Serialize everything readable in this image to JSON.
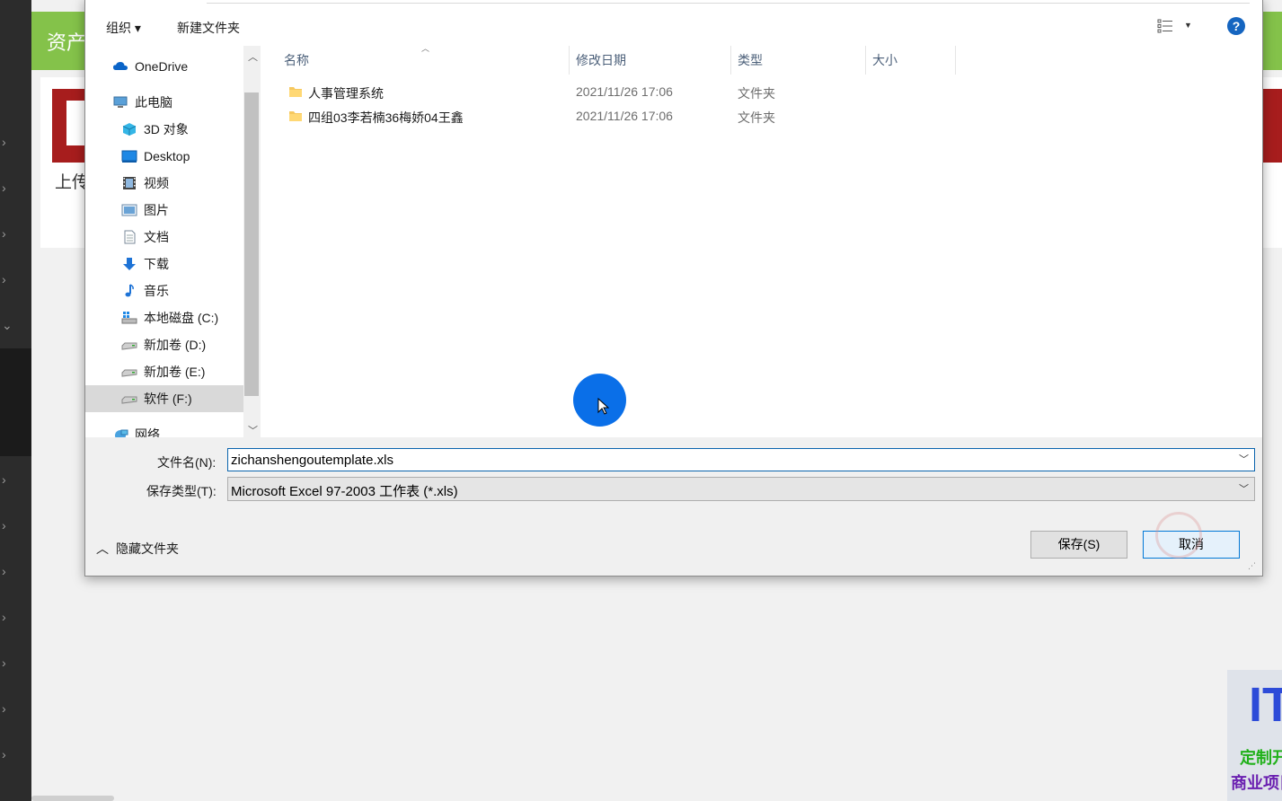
{
  "background": {
    "header_title": "资产",
    "upload_label": "上传",
    "ad": {
      "big": "IT",
      "line1": "定制开发",
      "line2": "商业项目"
    }
  },
  "dialog": {
    "toolbar": {
      "organize": "组织 ▾",
      "new_folder": "新建文件夹",
      "help": "?"
    },
    "nav": {
      "items": [
        {
          "label": "OneDrive",
          "icon": "cloud-icon"
        },
        {
          "label": "此电脑",
          "icon": "computer-icon"
        },
        {
          "label": "3D 对象",
          "icon": "cube-icon"
        },
        {
          "label": "Desktop",
          "icon": "desktop-icon"
        },
        {
          "label": "视频",
          "icon": "video-icon"
        },
        {
          "label": "图片",
          "icon": "picture-icon"
        },
        {
          "label": "文档",
          "icon": "document-icon"
        },
        {
          "label": "下载",
          "icon": "download-icon"
        },
        {
          "label": "音乐",
          "icon": "music-icon"
        },
        {
          "label": "本地磁盘 (C:)",
          "icon": "system-drive-icon"
        },
        {
          "label": "新加卷 (D:)",
          "icon": "drive-icon"
        },
        {
          "label": "新加卷 (E:)",
          "icon": "drive-icon"
        },
        {
          "label": "软件 (F:)",
          "icon": "drive-icon",
          "selected": true
        },
        {
          "label": "网络",
          "icon": "network-icon"
        }
      ]
    },
    "columns": {
      "name": "名称",
      "date": "修改日期",
      "type": "类型",
      "size": "大小"
    },
    "files": [
      {
        "name": "人事管理系统",
        "date": "2021/11/26 17:06",
        "type": "文件夹"
      },
      {
        "name": "四组03李若楠36梅娇04王鑫",
        "date": "2021/11/26 17:06",
        "type": "文件夹"
      }
    ],
    "filename_label": "文件名(N):",
    "filename_value": "zichanshengoutemplate.xls",
    "filetype_label": "保存类型(T):",
    "filetype_value": "Microsoft Excel 97-2003 工作表 (*.xls)",
    "hide_folders": "隐藏文件夹",
    "save_button": "保存(S)",
    "cancel_button": "取消"
  },
  "colors": {
    "accent": "#0078d7",
    "header_green": "#84c24a",
    "cursor_blue": "#0a6fe8"
  }
}
